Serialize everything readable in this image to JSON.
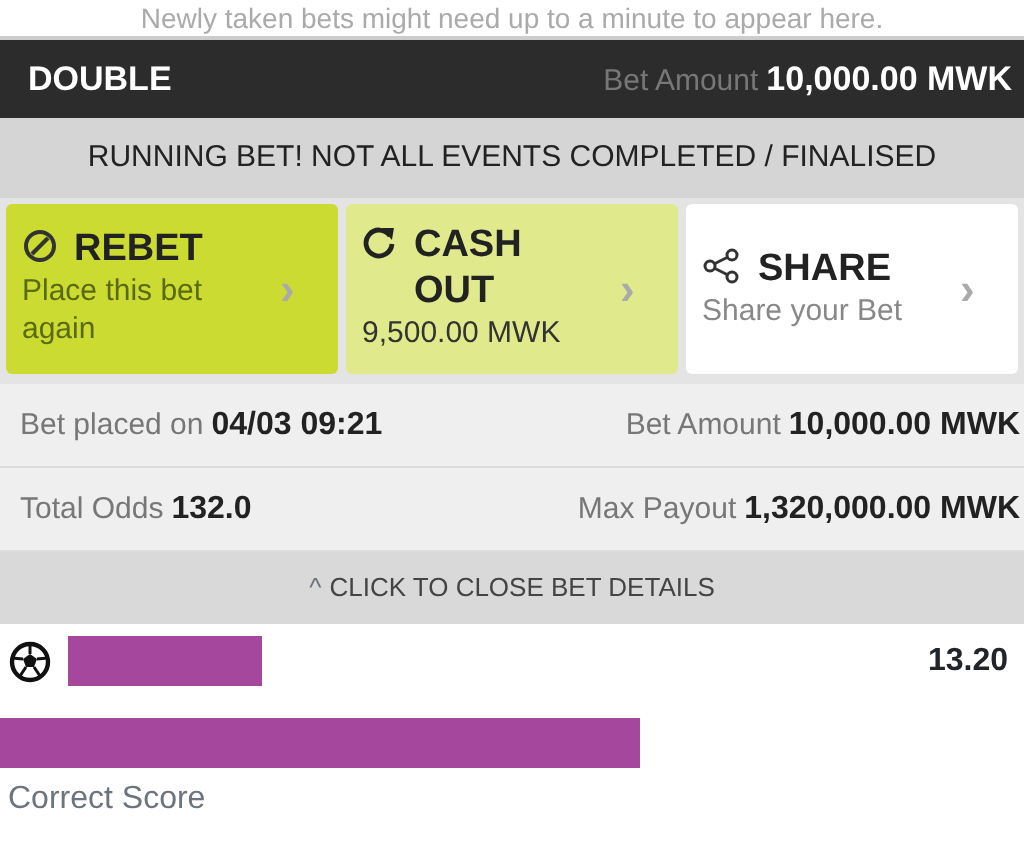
{
  "notice": "Newly taken bets might need up to a minute to appear here.",
  "header": {
    "type": "DOUBLE",
    "amount_label": "Bet Amount",
    "amount": "10,000.00 MWK"
  },
  "status": "RUNNING BET! NOT ALL EVENTS COMPLETED / FINALISED",
  "actions": [
    {
      "kind": "rebet",
      "title": "REBET",
      "subtitle": "Place this bet again",
      "arrow": "›"
    },
    {
      "kind": "cashout",
      "title": "CASH OUT",
      "subtitle": "9,500.00 MWK",
      "arrow": "›"
    },
    {
      "kind": "share",
      "title": "SHARE",
      "subtitle": "Share your Bet",
      "arrow": "›"
    }
  ],
  "details": [
    [
      {
        "label": "Bet placed on",
        "value": "04/03 09:21"
      },
      {
        "label": "Bet Amount",
        "value": "10,000.00 MWK"
      }
    ],
    [
      {
        "label": "Total Odds",
        "value": "132.0"
      },
      {
        "label": "Max Payout",
        "value": "1,320,000.00 MWK"
      }
    ]
  ],
  "toggle": {
    "arrow": "^",
    "label": "CLICK TO CLOSE BET DETAILS"
  },
  "event": {
    "odds": "13.20",
    "market": "Correct Score"
  }
}
